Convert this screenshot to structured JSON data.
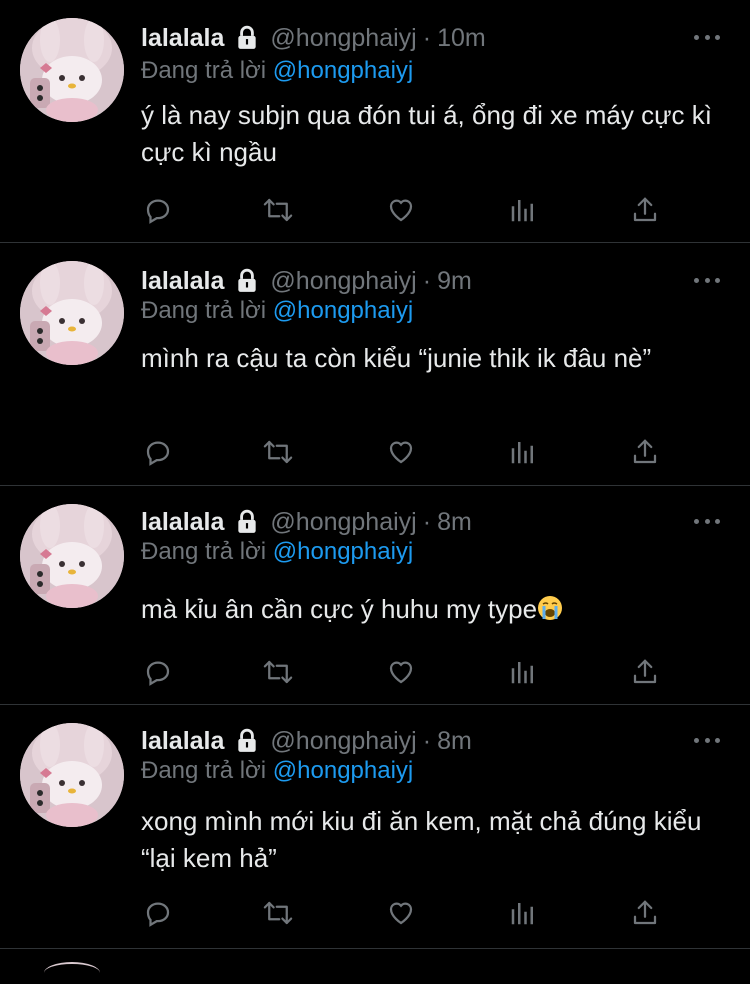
{
  "tweets": [
    {
      "display_name": "lalalala",
      "handle": "@hongphaiyj",
      "time": "10m",
      "reply_prefix": "Đang trả lời",
      "reply_to": "@hongphaiyj",
      "text": "ý là nay subjn qua đón tui á, ổng đi xe máy cực kì cực kì ngầu",
      "emoji": ""
    },
    {
      "display_name": "lalalala",
      "handle": "@hongphaiyj",
      "time": "9m",
      "reply_prefix": "Đang trả lời",
      "reply_to": "@hongphaiyj",
      "text": "mình ra cậu ta còn kiểu “junie thik ik đâu nè”",
      "emoji": ""
    },
    {
      "display_name": "lalalala",
      "handle": "@hongphaiyj",
      "time": "8m",
      "reply_prefix": "Đang trả lời",
      "reply_to": "@hongphaiyj",
      "text": "mà kỉu ân cần cực ý huhu my type",
      "emoji": "loudly-crying-face"
    },
    {
      "display_name": "lalalala",
      "handle": "@hongphaiyj",
      "time": "8m",
      "reply_prefix": "Đang trả lời",
      "reply_to": "@hongphaiyj",
      "text": "xong mình mới kiu đi ăn kem, mặt chả đúng kiểu “lại kem hả”",
      "emoji": ""
    }
  ],
  "action_icons": [
    "reply-icon",
    "retweet-icon",
    "like-icon",
    "analytics-icon",
    "share-icon"
  ],
  "colors": {
    "background": "#000000",
    "text": "#e7e9ea",
    "muted": "#71767b",
    "mention": "#1d9bf0",
    "divider": "#2f3336"
  }
}
